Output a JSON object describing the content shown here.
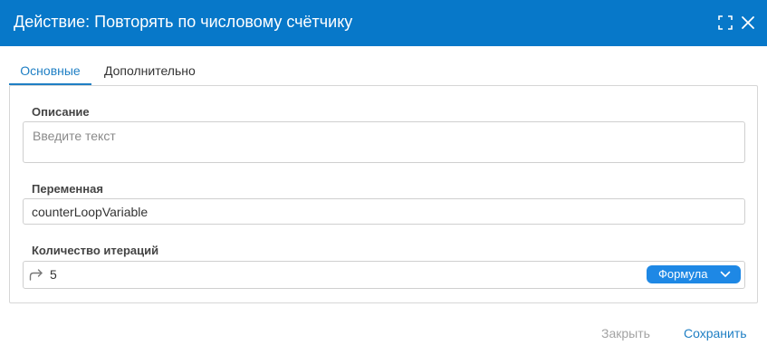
{
  "dialog": {
    "title": "Действие: Повторять по числовому счётчику"
  },
  "tabs": [
    {
      "label": "Основные",
      "active": true
    },
    {
      "label": "Дополнительно",
      "active": false
    }
  ],
  "form": {
    "description": {
      "label": "Описание",
      "placeholder": "Введите текст",
      "value": ""
    },
    "variable": {
      "label": "Переменная",
      "value": "counterLoopVariable"
    },
    "iterations": {
      "label": "Количество итераций",
      "value": "5",
      "mode": "Формула"
    }
  },
  "footer": {
    "close_label": "Закрыть",
    "save_label": "Сохранить"
  },
  "icons": {
    "maximize": "maximize-icon",
    "close": "close-icon",
    "repeat": "repeat-icon",
    "chevron": "chevron-down-icon"
  },
  "colors": {
    "header": "#0778c9",
    "accent": "#1f7fc4",
    "formula_badge": "#1e88e5"
  }
}
